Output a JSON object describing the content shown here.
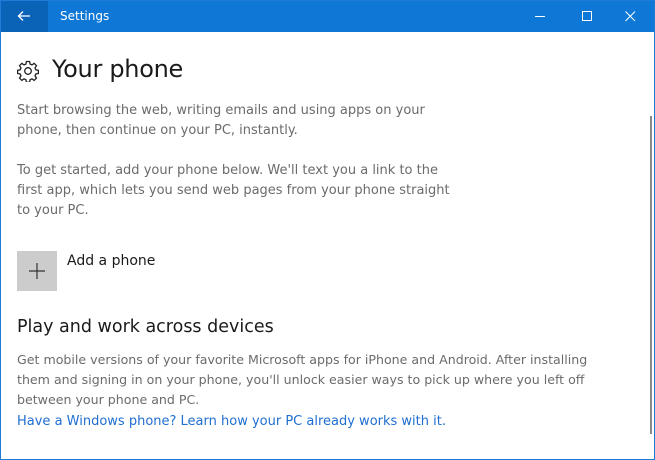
{
  "window": {
    "title": "Settings",
    "accent": "#0f78d7",
    "icons": [
      "back-arrow-icon",
      "minimize-icon",
      "maximize-icon",
      "close-icon"
    ]
  },
  "page": {
    "icon": "gear-icon",
    "title": "Your phone",
    "intro": "Start browsing the web, writing emails and using apps on your\nphone, then continue on your PC, instantly.",
    "instructions": "To get started, add your phone below. We'll text you a link to the\nfirst app, which lets you send web pages from your phone straight\nto your PC."
  },
  "add_phone": {
    "icon": "plus-icon",
    "label": "Add a phone"
  },
  "devices_section": {
    "title": "Play and work across devices",
    "body": "Get mobile versions of your favorite Microsoft apps for iPhone and Android. After installing\nthem and signing in on your phone, you'll unlock easier ways to pick up where you left off\nbetween your phone and PC.",
    "link": "Have a Windows phone? Learn how your PC already works with it.",
    "link_color": "#1f6ed0"
  }
}
